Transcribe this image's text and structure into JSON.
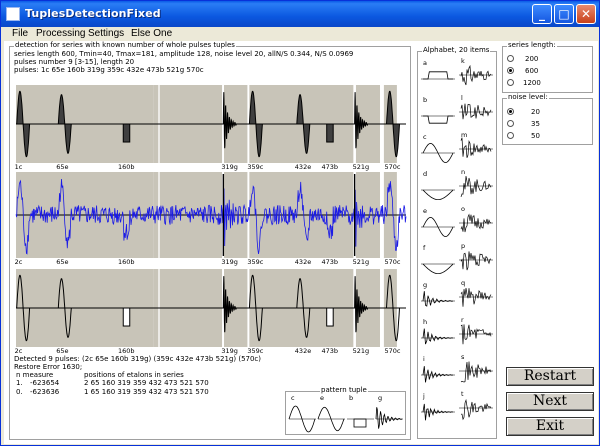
{
  "window": {
    "title": "TuplesDetectionFixed"
  },
  "menu": [
    "File",
    "Processing",
    "Settings",
    "Else One"
  ],
  "detection": {
    "group_label": "detection for series with known number of whole pulses tuples",
    "params_line": "series length 600,  Tmin=40,  Tmax=181,   amplitude 128,  noise level 20,  allN/S 0.344,   N/S 0.0969",
    "pulses_number": "pulses number 9 [3-15], length 20",
    "pulses_list": "pulses:  1c 65e 160b 319g 359c 432e 473b 521g 570c",
    "axis_labels": [
      "1c",
      "65e",
      "160b",
      "319g",
      "359c",
      "432e",
      "473b",
      "521g",
      "570c"
    ],
    "axis_labels_2": [
      "2c",
      "65e",
      "160b",
      "319g",
      "359c",
      "432e",
      "473b",
      "521g",
      "570c"
    ],
    "axis_labels_3": [
      "2c",
      "65e",
      "160b",
      "319g",
      "359c",
      "432e",
      "473b",
      "521g",
      "570c"
    ],
    "result_line": "Detected 9 pulses:  (2c 65e 160b 319g)  (359c 432e 473b 521g)  (570c)",
    "restore_error": "Restore Error 1630;",
    "table_head": "n  measure",
    "positions_head": "positions of etalons in series",
    "rows": [
      {
        "n": "1.",
        "measure": "-623654",
        "positions": "2  65  160  319  359  432  473  521  570"
      },
      {
        "n": "0.",
        "measure": "-623636",
        "positions": "1  65  160  319  359  432  473  521  570"
      }
    ]
  },
  "pattern_tuple": {
    "label": "pattern tuple",
    "letters": [
      "c",
      "e",
      "b",
      "g"
    ]
  },
  "alphabet": {
    "label": "Alphabet, 20 items",
    "left_letters": [
      "a",
      "b",
      "c",
      "d",
      "e",
      "f",
      "g",
      "h",
      "i",
      "j"
    ],
    "right_letters": [
      "k",
      "l",
      "m",
      "n",
      "o",
      "p",
      "q",
      "r",
      "s",
      "t"
    ]
  },
  "series_length": {
    "label": "series length:",
    "options": [
      "200",
      "600",
      "1200"
    ],
    "selected": 1
  },
  "noise_level": {
    "label": "noise level:",
    "options": [
      "20",
      "35",
      "50"
    ],
    "selected": 0
  },
  "buttons": {
    "restart": "Restart",
    "next": "Next",
    "exit": "Exit"
  }
}
